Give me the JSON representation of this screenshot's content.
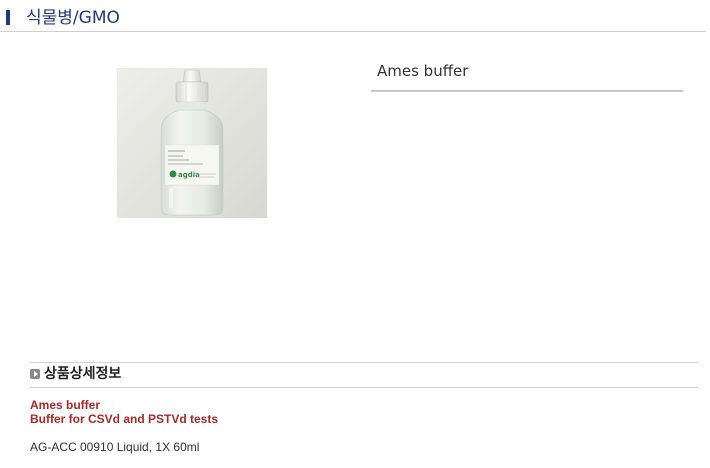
{
  "header": {
    "title": "식물병/GMO"
  },
  "product": {
    "image_alt": "Ames buffer bottle",
    "image_label_brand": "agdia",
    "name": "Ames buffer"
  },
  "details": {
    "section_title": "상품상세정보",
    "highlight_line1": "Ames buffer",
    "highlight_line2": "Buffer for CSVd and PSTVd tests",
    "spec": "AG-ACC 00910 Liquid, 1X 60ml"
  },
  "colors": {
    "accent_navy": "#1f3c7a",
    "highlight_red": "#a52a2a",
    "logo_green": "#2e8b3e"
  }
}
